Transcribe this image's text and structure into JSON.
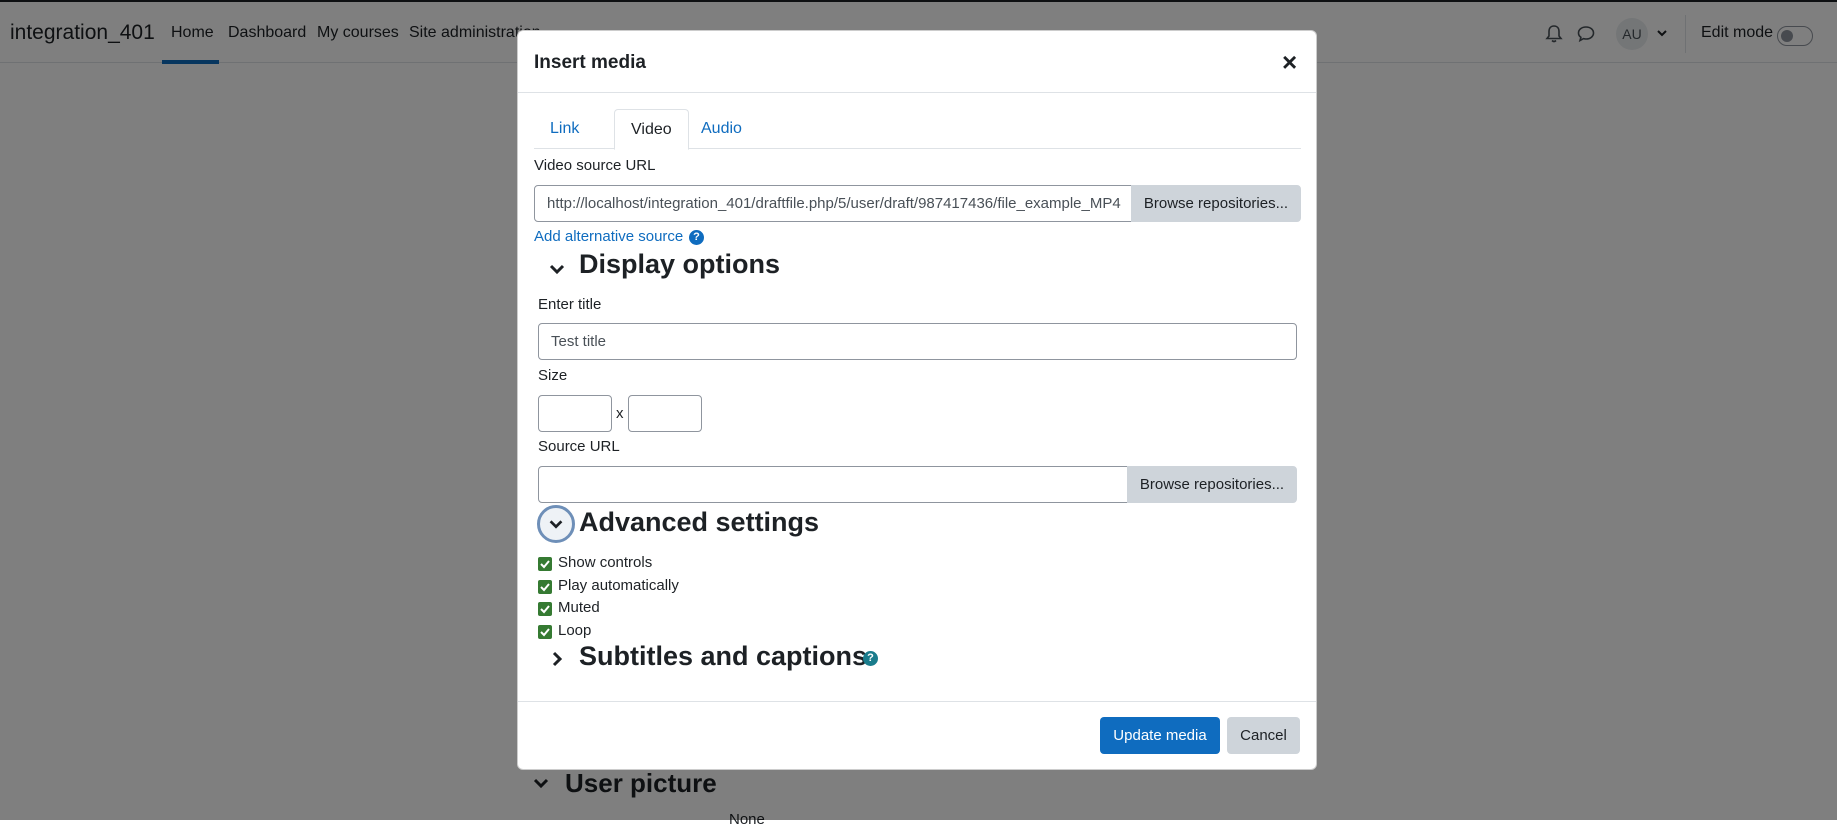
{
  "navbar": {
    "brand": "integration_401",
    "links": [
      "Home",
      "Dashboard",
      "My courses",
      "Site administration"
    ],
    "avatar_initials": "AU",
    "edit_mode_label": "Edit mode"
  },
  "background": {
    "section_title": "User picture",
    "none_text": "None"
  },
  "modal": {
    "title": "Insert media",
    "close_symbol": "×",
    "tabs": [
      "Link",
      "Video",
      "Audio"
    ],
    "active_tab": "Video",
    "video_source_label": "Video source URL",
    "video_source_value": "http://localhost/integration_401/draftfile.php/5/user/draft/987417436/file_example_MP4",
    "browse_label": "Browse repositories...",
    "add_alt_source": "Add alternative source",
    "help_symbol": "?",
    "display_options": {
      "heading": "Display options",
      "enter_title_label": "Enter title",
      "title_value": "Test title",
      "size_label": "Size",
      "size_separator": "x",
      "source_url_label": "Source URL",
      "source_url_value": ""
    },
    "advanced": {
      "heading": "Advanced settings",
      "checks": [
        {
          "label": "Show controls",
          "checked": true
        },
        {
          "label": "Play automatically",
          "checked": true
        },
        {
          "label": "Muted",
          "checked": true
        },
        {
          "label": "Loop",
          "checked": true
        }
      ]
    },
    "subtitles_heading": "Subtitles and captions",
    "update_button": "Update media",
    "cancel_button": "Cancel"
  },
  "colors": {
    "primary": "#0f6cbf",
    "checkbox": "#357a32",
    "secondary_btn": "#ced4da"
  }
}
